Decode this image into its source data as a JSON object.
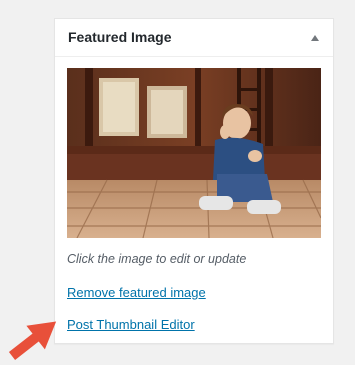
{
  "metabox": {
    "title": "Featured Image",
    "toggle_icon": "triangle-up-icon"
  },
  "image": {
    "alt": "Child sitting on wooden porch"
  },
  "hint_text": "Click the image to edit or update",
  "links": {
    "remove": "Remove featured image",
    "editor": "Post Thumbnail Editor"
  },
  "colors": {
    "link": "#0073aa",
    "arrow": "#e8503a",
    "title": "#23282d"
  }
}
